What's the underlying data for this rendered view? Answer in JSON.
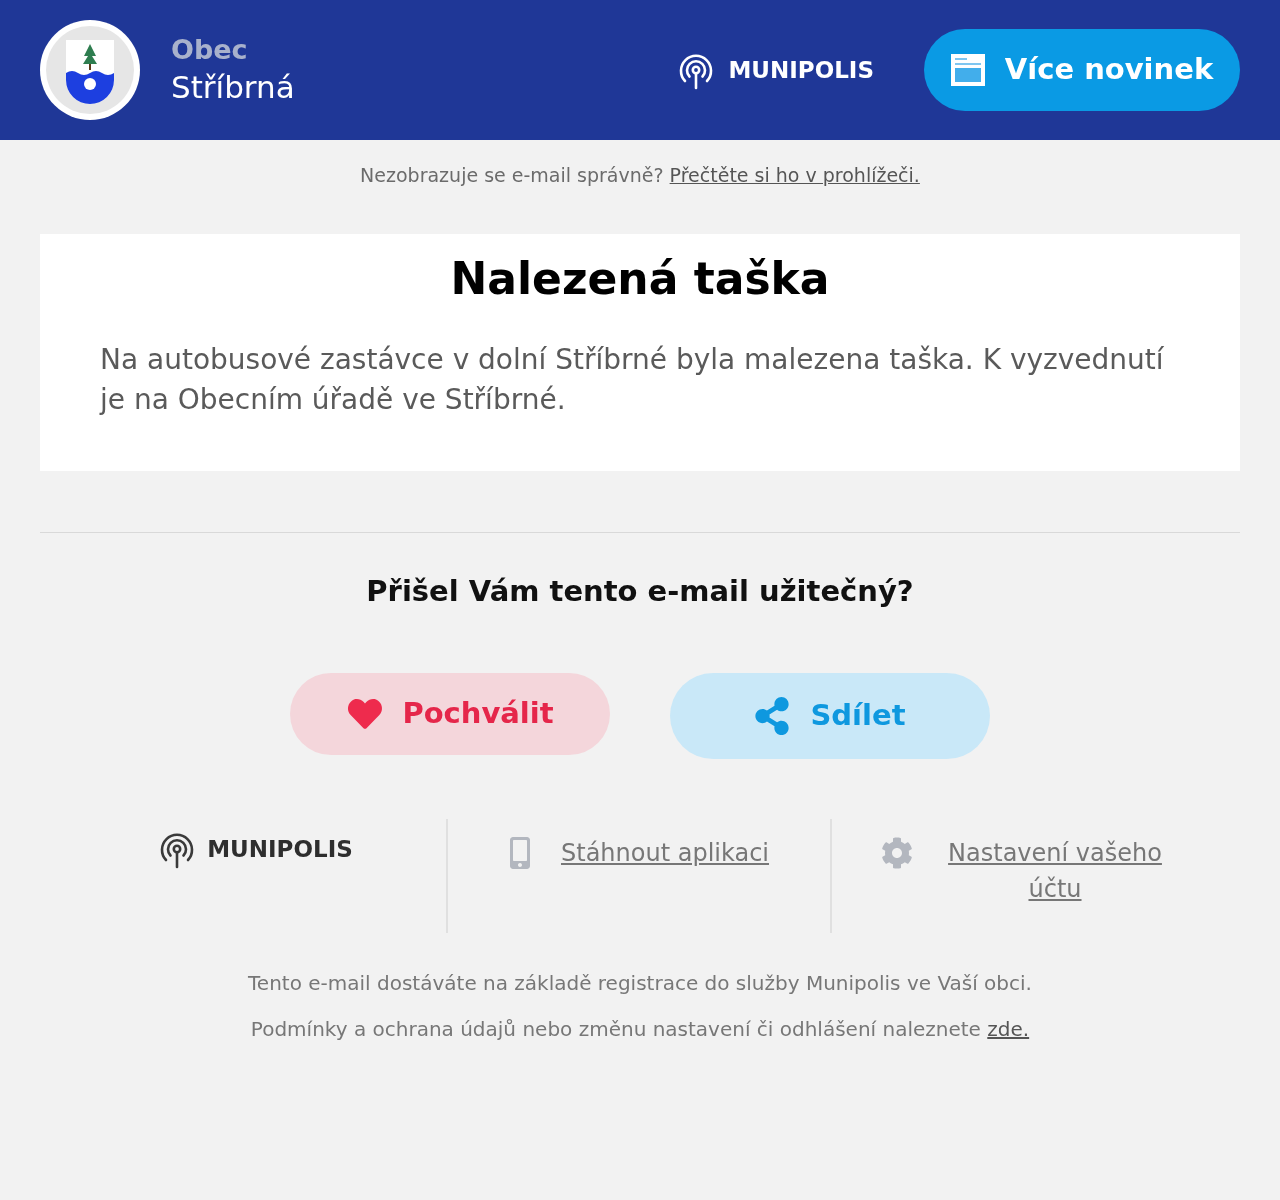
{
  "header": {
    "logo_prefix": "Obec",
    "municipality": "Stříbrná",
    "brand": "MUNIPOLIS",
    "more_news_button": "Více novinek"
  },
  "browser_notice": {
    "text": "Nezobrazuje se e-mail správně?",
    "link": "Přečtěte si ho v prohlížeči."
  },
  "article": {
    "title": "Nalezená taška",
    "body": "Na autobusové zastávce v dolní Stříbrné byla malezena taška. K vyzvednutí je na Obecním úřadě ve Stříbrné."
  },
  "feedback": {
    "question": "Přišel Vám tento e-mail užitečný?",
    "buttons": [
      {
        "kind": "praise",
        "label": "Pochválit"
      },
      {
        "kind": "share",
        "label": "Sdílet"
      }
    ]
  },
  "footer_links": {
    "brand": "MUNIPOLIS",
    "items": [
      {
        "kind": "app",
        "label": "Stáhnout aplikaci"
      },
      {
        "kind": "settings",
        "label": "Nastavení vašeho účtu"
      }
    ]
  },
  "disclaimer": {
    "registration": "Tento e-mail dostáváte na základě registrace do služby Munipolis ve Vaší obci.",
    "terms": "Podmínky a ochrana údajů nebo změnu nastavení či odhlášení naleznete",
    "terms_link": "zde."
  }
}
